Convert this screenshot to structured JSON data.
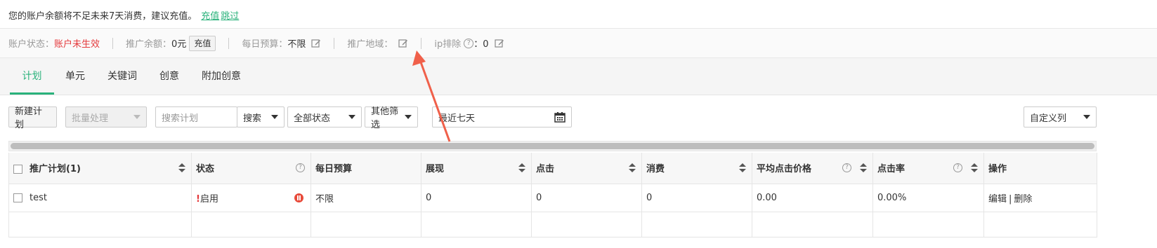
{
  "notice": {
    "text": "您的账户余额将不足未来7天消费，建议充值。",
    "recharge_link": "充值",
    "skip_link": "跳过"
  },
  "status": {
    "account_label": "账户状态：",
    "account_value": "账户未生效",
    "balance_label": "推广余额：",
    "balance_value": "0元",
    "recharge_button": "充值",
    "budget_label": "每日预算：",
    "budget_value": "不限",
    "region_label": "推广地域：",
    "ip_label": "ip排除",
    "ip_value": "：0"
  },
  "tabs": [
    {
      "label": "计划",
      "active": true
    },
    {
      "label": "单元"
    },
    {
      "label": "关键词"
    },
    {
      "label": "创意"
    },
    {
      "label": "附加创意"
    }
  ],
  "toolbar": {
    "new_plan": "新建计划",
    "batch": "批量处理",
    "search_placeholder": "搜索计划",
    "search_button": "搜索",
    "status_filter": "全部状态",
    "other_filter": "其他筛选",
    "date_range": "最近七天",
    "custom_columns": "自定义列"
  },
  "table": {
    "headers": {
      "plan": "推广计划(1)",
      "status": "状态",
      "budget": "每日预算",
      "impressions": "展现",
      "clicks": "点击",
      "cost": "消费",
      "avg_cpc": "平均点击价格",
      "ctr": "点击率",
      "actions": "操作"
    },
    "rows": [
      {
        "plan": "test",
        "status_mark": "!",
        "status": "启用",
        "budget": "不限",
        "impressions": "0",
        "clicks": "0",
        "cost": "0",
        "avg_cpc": "0.00",
        "ctr": "0.00%",
        "edit": "编辑",
        "sep": "|",
        "delete": "删除"
      }
    ]
  },
  "colors": {
    "accent": "#2ab27b",
    "warning": "#e4393c",
    "arrow": "#f0604a"
  }
}
